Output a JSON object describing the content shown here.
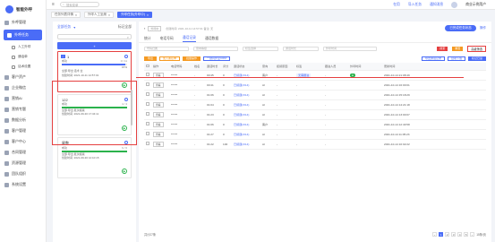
{
  "app": {
    "name": "智能外呼"
  },
  "sidebar": {
    "items": [
      {
        "label": "外呼管理",
        "sub": false,
        "active": false
      },
      {
        "label": "外呼任务",
        "sub": false,
        "active": true
      },
      {
        "label": "人工外呼",
        "sub": true
      },
      {
        "label": "通话单",
        "sub": true
      },
      {
        "label": "话术设置",
        "sub": true
      },
      {
        "label": "客户资产",
        "sub": false
      },
      {
        "label": "企业微信",
        "sub": false
      },
      {
        "label": "营销Ai",
        "sub": false
      },
      {
        "label": "营销专题",
        "sub": false
      },
      {
        "label": "数据分析",
        "sub": false
      },
      {
        "label": "客户管理",
        "sub": false
      },
      {
        "label": "客户中心",
        "sub": false
      },
      {
        "label": "合同管理",
        "sub": false
      },
      {
        "label": "资源管理",
        "sub": false
      },
      {
        "label": "团队组织",
        "sub": false
      },
      {
        "label": "系统设置",
        "sub": false
      }
    ]
  },
  "topbar": {
    "search_placeholder": "搜索菜单",
    "links": [
      "在用",
      "导入任务",
      "通知消息"
    ],
    "user": "商业示例用户"
  },
  "page_tabs": [
    {
      "label": "任务列表详情",
      "active": false
    },
    {
      "label": "外呼人工坐席",
      "active": false
    },
    {
      "label": "外呼任务(外呼中)",
      "active": true
    }
  ],
  "left": {
    "filter": "全部任务",
    "toggle": "标记全部",
    "add_label": "+",
    "cards": [
      {
        "num": "1",
        "count": "0 / 11",
        "progress": 0.97,
        "pct": "97%",
        "status": "成功",
        "line1": "全部:导出 话术 全",
        "line2": "创建时间: 2021-10-11 14:57:01",
        "selected": true,
        "color": "#4a6cf7"
      },
      {
        "num": "122",
        "count": "4 / 4",
        "progress": 1.0,
        "pct": "",
        "status": "成功",
        "line1": "全部:导出 批次模版",
        "line2": "创建时间: 2021-09-30 17:34:11",
        "selected": false,
        "color": "#2bb24c"
      },
      {
        "num": "尾数",
        "count": "6 / 6",
        "progress": 1.0,
        "pct": "",
        "status": "成功",
        "line1": "全部:导出 批次模版",
        "line2": "创建时间: 2021-09-30 12:10:15",
        "selected": false,
        "color": "#2bb24c"
      }
    ]
  },
  "main": {
    "badge": "外呼中",
    "meta": "创建时间: 2021-10-11 14:57:01  备注: 无",
    "top_btn": "已完成任务状态",
    "more": "操作",
    "tabs": [
      {
        "label": "统计",
        "on": false
      },
      {
        "label": "电话号码",
        "on": false
      },
      {
        "label": "通话记录",
        "on": true
      },
      {
        "label": "通话数据",
        "on": false
      }
    ],
    "filters": [
      "号码归属",
      "意向等级",
      "标签选择",
      "通话时长",
      "外呼时间"
    ],
    "filter_red": "搜索",
    "filter_orange": "重置",
    "filter_box": "高级筛选",
    "actions": [
      "导出",
      "加入黑名单",
      "批量操作",
      "一键同步至CRM"
    ],
    "actions_right": [
      "导出通话记录",
      "自动下载",
      "标记已读"
    ],
    "columns": [
      "",
      "操作",
      "电话号码",
      "姓名",
      "通话时长",
      "评分",
      "通话状态",
      "意向",
      "拒接原因",
      "标签",
      "跟进人员",
      "外呼时间",
      "更新时间"
    ],
    "rows": [
      {
        "op": "查看",
        "phone": "******",
        "name": "-",
        "dur": "00:45",
        "score": "0",
        "status": "已接通(3/14)",
        "intent": "客户",
        "reason": "-",
        "tag": "无需跟进",
        "follower": "-",
        "time": "2021-10-14 21:08:49"
      },
      {
        "op": "查看",
        "phone": "******",
        "name": "-",
        "dur": "00:41",
        "score": "0",
        "status": "已接通(3/14)",
        "intent": "AI",
        "reason": "-",
        "tag": "-",
        "follower": "-",
        "time": "2021-10-14 16:00:01"
      },
      {
        "op": "查看",
        "phone": "******",
        "name": "-",
        "dur": "01:06",
        "score": "0",
        "status": "已接通(3/14)",
        "intent": "AI",
        "reason": "-",
        "tag": "-",
        "follower": "-",
        "time": "2021-10-14 15:18:29"
      },
      {
        "op": "查看",
        "phone": "******",
        "name": "-",
        "dur": "01:04",
        "score": "0",
        "status": "已接通(3/14)",
        "intent": "AI",
        "reason": "-",
        "tag": "-",
        "follower": "-",
        "time": "2021-10-14 14:21:18"
      },
      {
        "op": "查看",
        "phone": "******",
        "name": "-",
        "dur": "01:23",
        "score": "0",
        "status": "已接通(3/14)",
        "intent": "AI",
        "reason": "-",
        "tag": "-",
        "follower": "-",
        "time": "2021-10-14 13:00:07"
      },
      {
        "op": "查看",
        "phone": "******",
        "name": "-",
        "dur": "01:06",
        "score": "0",
        "status": "已接通(3/14)",
        "intent": "客户",
        "reason": "-",
        "tag": "-",
        "follower": "-",
        "time": "2021-10-14 12:40:58"
      },
      {
        "op": "查看",
        "phone": "******",
        "name": "-",
        "dur": "01:27",
        "score": "0",
        "status": "已接通(3/14)",
        "intent": "AI",
        "reason": "-",
        "tag": "-",
        "follower": "-",
        "time": "2021-10-14 11:05:23"
      },
      {
        "op": "查看",
        "phone": "******",
        "name": "-",
        "dur": "01:22",
        "score": "100",
        "status": "已接通(3/14)",
        "intent": "AI",
        "reason": "-",
        "tag": "-",
        "follower": "-",
        "time": "2021-10-14 10:02:22"
      }
    ],
    "footer": {
      "total": "共计27条",
      "pages": [
        "1",
        "2",
        "3",
        "4",
        "5"
      ],
      "per": "15条/页"
    }
  },
  "colors": {
    "accent": "#4a6cf7",
    "danger": "#e54040",
    "warn": "#f59a23",
    "ok": "#2bb24c"
  }
}
